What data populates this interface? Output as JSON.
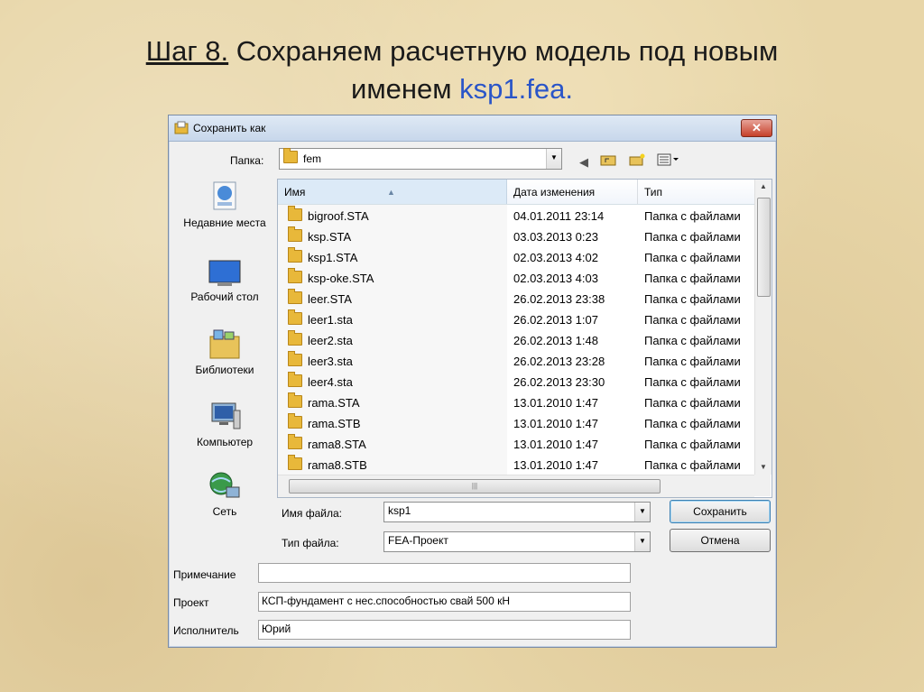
{
  "slide": {
    "title_step": "Шаг 8.",
    "title_text": " Сохраняем расчетную модель под новым",
    "title_line2_prefix": "именем ",
    "title_filename": "ksp1.fea",
    "title_end": "."
  },
  "dialog": {
    "title": "Сохранить как",
    "close_glyph": "✕",
    "folder_label": "Папка:",
    "folder_value": "fem",
    "places": [
      {
        "label": "Недавние места",
        "icon": "recent-places-icon"
      },
      {
        "label": "Рабочий стол",
        "icon": "desktop-icon"
      },
      {
        "label": "Библиотеки",
        "icon": "libraries-icon"
      },
      {
        "label": "Компьютер",
        "icon": "computer-icon"
      },
      {
        "label": "Сеть",
        "icon": "network-icon"
      }
    ],
    "columns": {
      "name": "Имя",
      "date": "Дата изменения",
      "type": "Тип"
    },
    "files": [
      {
        "name": "bigroof.STA",
        "date": "04.01.2011 23:14",
        "type": "Папка с файлами"
      },
      {
        "name": "ksp.STA",
        "date": "03.03.2013 0:23",
        "type": "Папка с файлами"
      },
      {
        "name": "ksp1.STA",
        "date": "02.03.2013 4:02",
        "type": "Папка с файлами"
      },
      {
        "name": "ksp-oke.STA",
        "date": "02.03.2013 4:03",
        "type": "Папка с файлами"
      },
      {
        "name": "leer.STA",
        "date": "26.02.2013 23:38",
        "type": "Папка с файлами"
      },
      {
        "name": "leer1.sta",
        "date": "26.02.2013 1:07",
        "type": "Папка с файлами"
      },
      {
        "name": "leer2.sta",
        "date": "26.02.2013 1:48",
        "type": "Папка с файлами"
      },
      {
        "name": "leer3.sta",
        "date": "26.02.2013 23:28",
        "type": "Папка с файлами"
      },
      {
        "name": "leer4.sta",
        "date": "26.02.2013 23:30",
        "type": "Папка с файлами"
      },
      {
        "name": "rama.STA",
        "date": "13.01.2010 1:47",
        "type": "Папка с файлами"
      },
      {
        "name": "rama.STB",
        "date": "13.01.2010 1:47",
        "type": "Папка с файлами"
      },
      {
        "name": "rama8.STA",
        "date": "13.01.2010 1:47",
        "type": "Папка с файлами"
      },
      {
        "name": "rama8.STB",
        "date": "13.01.2010 1:47",
        "type": "Папка с файлами"
      }
    ],
    "filename_label": "Имя файла:",
    "filename_value": "ksp1",
    "filetype_label": "Тип файла:",
    "filetype_value": "FEA-Проект",
    "save_button": "Сохранить",
    "cancel_button": "Отмена",
    "note_label": "Примечание",
    "note_value": "",
    "project_label": "Проект",
    "project_value": "КСП-фундамент с нес.способностью свай 500 кН",
    "author_label": "Исполнитель",
    "author_value": "Юрий"
  }
}
